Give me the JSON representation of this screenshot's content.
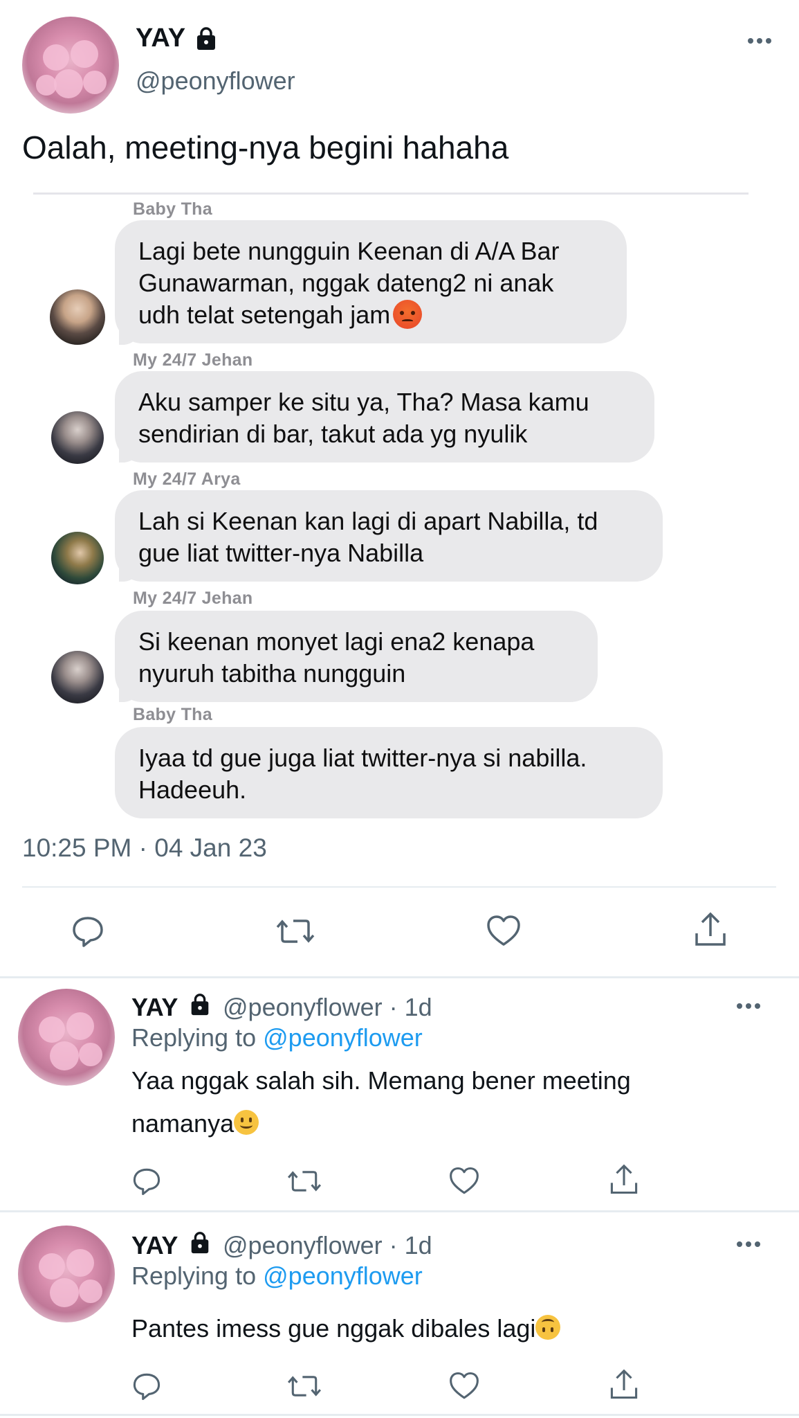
{
  "main_tweet": {
    "display_name": "YAY",
    "handle": "@peonyflower",
    "text": "Oalah, meeting-nya begini hahaha",
    "timestamp": "10:25 PM · 04 Jan 23",
    "icons": {
      "lock": "lock-icon",
      "more": "more-icon"
    }
  },
  "chat": {
    "messages": [
      {
        "sender": "Baby Tha",
        "lines": [
          "Lagi bete nungguin Keenan di A/A Bar",
          "Gunawarman, nggak dateng2 ni anak",
          "udh telat setengah jam"
        ],
        "emoji": "angry-face-emoji"
      },
      {
        "sender": "My 24/7 Jehan",
        "lines": [
          "Aku samper ke situ ya, Tha? Masa kamu",
          "sendirian di bar, takut ada yg nyulik"
        ]
      },
      {
        "sender": "My 24/7 Arya",
        "lines": [
          "Lah si Keenan kan lagi di apart Nabilla, td",
          "gue liat twitter-nya Nabilla"
        ]
      },
      {
        "sender": "My 24/7 Jehan",
        "lines": [
          "Si keenan monyet lagi ena2 kenapa",
          "nyuruh tabitha nungguin"
        ]
      },
      {
        "sender": "Baby Tha",
        "lines": [
          "Iyaa td gue juga liat twitter-nya si nabilla.",
          "Hadeeuh."
        ]
      }
    ]
  },
  "actions": [
    "reply-icon",
    "retweet-icon",
    "like-icon",
    "share-icon"
  ],
  "replies": [
    {
      "display_name": "YAY",
      "handle_time": "@peonyflower · 1d",
      "replying_prefix": "Replying to",
      "replying_mention": "@peonyflower",
      "line1": "Yaa nggak salah sih. Memang bener meeting",
      "line2": "namanya",
      "emoji": "slightly-smiling-face-emoji"
    },
    {
      "display_name": "YAY",
      "handle_time": "@peonyflower · 1d",
      "replying_prefix": "Replying to",
      "replying_mention": "@peonyflower",
      "line1": "Pantes imess gue nggak dibales lagi",
      "emoji": "upside-down-face-emoji"
    }
  ],
  "colors": {
    "accent": "#1d9bf0",
    "secondary_text": "#536471",
    "bubble": "#e9e9eb"
  }
}
